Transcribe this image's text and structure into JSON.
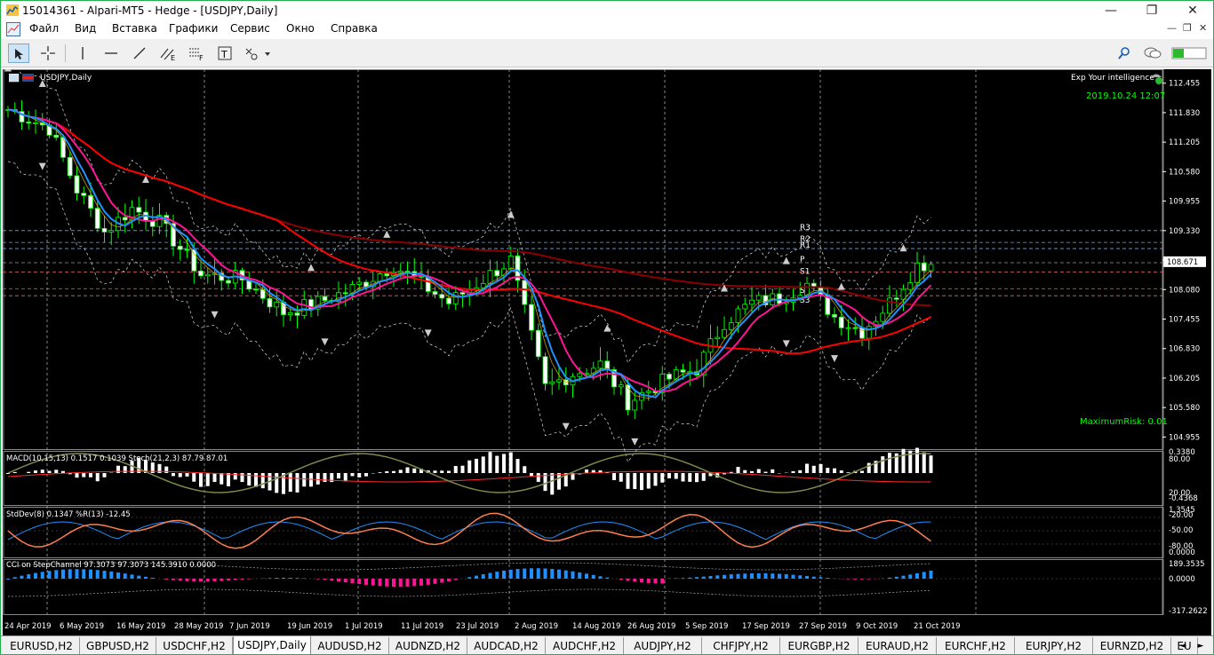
{
  "window": {
    "title": "15014361 - Alpari-MT5 - Hedge - [USDJPY,Daily]",
    "controls": [
      "—",
      "❐",
      "✕"
    ]
  },
  "menu": {
    "items": [
      "Файл",
      "Вид",
      "Вставка",
      "Графики",
      "Сервис",
      "Окно",
      "Справка"
    ],
    "mdi_controls": [
      "—",
      "❐",
      "✕"
    ]
  },
  "chart": {
    "symbol_label": "USDJPY,Daily",
    "expert_label": "Exp Your intelligence",
    "server_time": "2019.10.24 12:07",
    "max_risk": "MaximumRisk: 0.01",
    "current_price": "108.671",
    "price_ticks": [
      "112.455",
      "111.830",
      "111.205",
      "110.580",
      "109.955",
      "109.330",
      "108.705",
      "108.080",
      "107.455",
      "106.830",
      "106.205",
      "105.580",
      "104.955"
    ],
    "date_ticks": [
      "24 Apr 2019",
      "6 May 2019",
      "16 May 2019",
      "28 May 2019",
      "7 Jun 2019",
      "19 Jun 2019",
      "1 Jul 2019",
      "11 Jul 2019",
      "23 Jul 2019",
      "2 Aug 2019",
      "14 Aug 2019",
      "26 Aug 2019",
      "5 Sep 2019",
      "17 Sep 2019",
      "27 Sep 2019",
      "9 Oct 2019",
      "21 Oct 2019"
    ],
    "pivot_labels": [
      "R3",
      "R2",
      "R1",
      "P",
      "S1",
      "S2",
      "S3"
    ],
    "colors": {
      "bull": "#00ff00",
      "bear": "#ffffff",
      "ma_fast": "#1e90ff",
      "ma_mid": "#ff1493",
      "ma_slow": "#ff0000",
      "ma_long": "#8b0000",
      "text_green": "#00ff00"
    }
  },
  "macd_panel": {
    "label": "MACD(10,15,13) 0.1517 0.1039 Stoch(21,2,3) 87.79 87.01",
    "ticks": [
      "0.3380",
      "80.00",
      "20.00",
      "-0.4368"
    ]
  },
  "stddev_panel": {
    "label": "StdDev(8) 0.1347 %R(13) -12.45",
    "ticks": [
      "1.3545",
      "-20.00",
      "-50.00",
      "-80.00",
      "0.0000"
    ]
  },
  "cci_panel": {
    "label": "CCI on StepChannel 97.3073 97.3073 145.3910 0.0000",
    "ticks": [
      "189.3535",
      "0.0000",
      "-317.2622"
    ]
  },
  "tabs": [
    "EURUSD,H2",
    "GBPUSD,H2",
    "USDCHF,H2",
    "USDJPY,Daily",
    "AUDUSD,H2",
    "AUDNZD,H2",
    "AUDCAD,H2",
    "AUDCHF,H2",
    "AUDJPY,H2",
    "CHFJPY,H2",
    "EURGBP,H2",
    "EURAUD,H2",
    "EURCHF,H2",
    "EURJPY,H2",
    "EURNZD,H2",
    "EU"
  ],
  "active_tab": "USDJPY,Daily",
  "tab_nav": [
    "◄",
    "►"
  ]
}
